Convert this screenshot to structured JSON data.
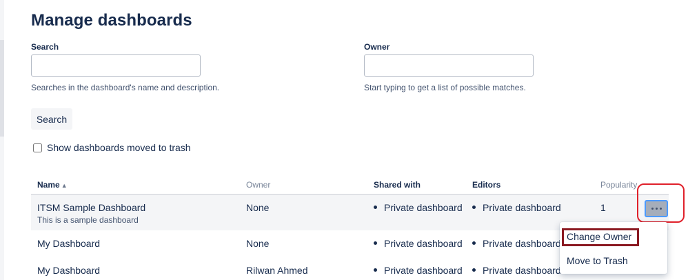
{
  "page": {
    "title": "Manage dashboards"
  },
  "search": {
    "label": "Search",
    "value": "",
    "placeholder": "",
    "help": "Searches in the dashboard's name and description."
  },
  "owner": {
    "label": "Owner",
    "value": "",
    "placeholder": "",
    "help": "Start typing to get a list of possible matches."
  },
  "search_button_label": "Search",
  "trash_toggle": {
    "label": "Show dashboards moved to trash",
    "checked": false
  },
  "table": {
    "columns": {
      "name": "Name",
      "owner": "Owner",
      "shared_with": "Shared with",
      "editors": "Editors",
      "popularity": "Popularity"
    },
    "sorted_by": "Name",
    "rows": [
      {
        "name": "ITSM Sample Dashboard",
        "description": "This is a sample dashboard",
        "owner": "None",
        "shared_with": "Private dashboard",
        "editors": "Private dashboard",
        "popularity": "1"
      },
      {
        "name": "My Dashboard",
        "description": "",
        "owner": "None",
        "shared_with": "Private dashboard",
        "editors": "Private dashboard",
        "popularity": ""
      },
      {
        "name": "My Dashboard",
        "description": "",
        "owner": "Rilwan Ahmed",
        "shared_with": "Private dashboard",
        "editors": "Private dashboard",
        "popularity": ""
      }
    ]
  },
  "actions_menu": {
    "button_icon": "more-horizontal-icon",
    "items": [
      "Change Owner",
      "Move to Trash"
    ]
  },
  "colors": {
    "text": "#172b4d",
    "muted": "#7a869a",
    "focus": "#4c9aff",
    "annotation_red": "#e0202a",
    "annotation_dark_red": "#8b1a22"
  }
}
